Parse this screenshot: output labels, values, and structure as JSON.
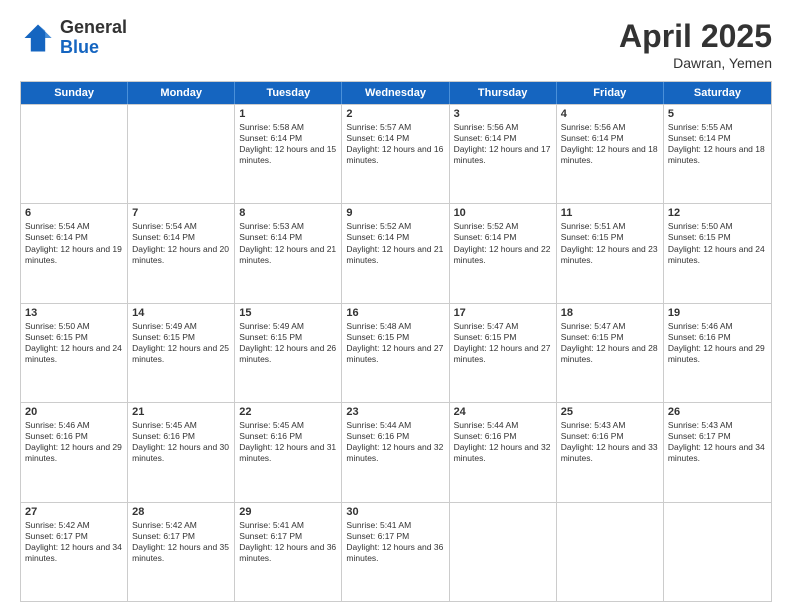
{
  "logo": {
    "general": "General",
    "blue": "Blue"
  },
  "title": {
    "main": "April 2025",
    "sub": "Dawran, Yemen"
  },
  "days": [
    "Sunday",
    "Monday",
    "Tuesday",
    "Wednesday",
    "Thursday",
    "Friday",
    "Saturday"
  ],
  "weeks": [
    [
      {
        "day": "",
        "info": ""
      },
      {
        "day": "",
        "info": ""
      },
      {
        "day": "1",
        "info": "Sunrise: 5:58 AM\nSunset: 6:14 PM\nDaylight: 12 hours and 15 minutes."
      },
      {
        "day": "2",
        "info": "Sunrise: 5:57 AM\nSunset: 6:14 PM\nDaylight: 12 hours and 16 minutes."
      },
      {
        "day": "3",
        "info": "Sunrise: 5:56 AM\nSunset: 6:14 PM\nDaylight: 12 hours and 17 minutes."
      },
      {
        "day": "4",
        "info": "Sunrise: 5:56 AM\nSunset: 6:14 PM\nDaylight: 12 hours and 18 minutes."
      },
      {
        "day": "5",
        "info": "Sunrise: 5:55 AM\nSunset: 6:14 PM\nDaylight: 12 hours and 18 minutes."
      }
    ],
    [
      {
        "day": "6",
        "info": "Sunrise: 5:54 AM\nSunset: 6:14 PM\nDaylight: 12 hours and 19 minutes."
      },
      {
        "day": "7",
        "info": "Sunrise: 5:54 AM\nSunset: 6:14 PM\nDaylight: 12 hours and 20 minutes."
      },
      {
        "day": "8",
        "info": "Sunrise: 5:53 AM\nSunset: 6:14 PM\nDaylight: 12 hours and 21 minutes."
      },
      {
        "day": "9",
        "info": "Sunrise: 5:52 AM\nSunset: 6:14 PM\nDaylight: 12 hours and 21 minutes."
      },
      {
        "day": "10",
        "info": "Sunrise: 5:52 AM\nSunset: 6:14 PM\nDaylight: 12 hours and 22 minutes."
      },
      {
        "day": "11",
        "info": "Sunrise: 5:51 AM\nSunset: 6:15 PM\nDaylight: 12 hours and 23 minutes."
      },
      {
        "day": "12",
        "info": "Sunrise: 5:50 AM\nSunset: 6:15 PM\nDaylight: 12 hours and 24 minutes."
      }
    ],
    [
      {
        "day": "13",
        "info": "Sunrise: 5:50 AM\nSunset: 6:15 PM\nDaylight: 12 hours and 24 minutes."
      },
      {
        "day": "14",
        "info": "Sunrise: 5:49 AM\nSunset: 6:15 PM\nDaylight: 12 hours and 25 minutes."
      },
      {
        "day": "15",
        "info": "Sunrise: 5:49 AM\nSunset: 6:15 PM\nDaylight: 12 hours and 26 minutes."
      },
      {
        "day": "16",
        "info": "Sunrise: 5:48 AM\nSunset: 6:15 PM\nDaylight: 12 hours and 27 minutes."
      },
      {
        "day": "17",
        "info": "Sunrise: 5:47 AM\nSunset: 6:15 PM\nDaylight: 12 hours and 27 minutes."
      },
      {
        "day": "18",
        "info": "Sunrise: 5:47 AM\nSunset: 6:15 PM\nDaylight: 12 hours and 28 minutes."
      },
      {
        "day": "19",
        "info": "Sunrise: 5:46 AM\nSunset: 6:16 PM\nDaylight: 12 hours and 29 minutes."
      }
    ],
    [
      {
        "day": "20",
        "info": "Sunrise: 5:46 AM\nSunset: 6:16 PM\nDaylight: 12 hours and 29 minutes."
      },
      {
        "day": "21",
        "info": "Sunrise: 5:45 AM\nSunset: 6:16 PM\nDaylight: 12 hours and 30 minutes."
      },
      {
        "day": "22",
        "info": "Sunrise: 5:45 AM\nSunset: 6:16 PM\nDaylight: 12 hours and 31 minutes."
      },
      {
        "day": "23",
        "info": "Sunrise: 5:44 AM\nSunset: 6:16 PM\nDaylight: 12 hours and 32 minutes."
      },
      {
        "day": "24",
        "info": "Sunrise: 5:44 AM\nSunset: 6:16 PM\nDaylight: 12 hours and 32 minutes."
      },
      {
        "day": "25",
        "info": "Sunrise: 5:43 AM\nSunset: 6:16 PM\nDaylight: 12 hours and 33 minutes."
      },
      {
        "day": "26",
        "info": "Sunrise: 5:43 AM\nSunset: 6:17 PM\nDaylight: 12 hours and 34 minutes."
      }
    ],
    [
      {
        "day": "27",
        "info": "Sunrise: 5:42 AM\nSunset: 6:17 PM\nDaylight: 12 hours and 34 minutes."
      },
      {
        "day": "28",
        "info": "Sunrise: 5:42 AM\nSunset: 6:17 PM\nDaylight: 12 hours and 35 minutes."
      },
      {
        "day": "29",
        "info": "Sunrise: 5:41 AM\nSunset: 6:17 PM\nDaylight: 12 hours and 36 minutes."
      },
      {
        "day": "30",
        "info": "Sunrise: 5:41 AM\nSunset: 6:17 PM\nDaylight: 12 hours and 36 minutes."
      },
      {
        "day": "",
        "info": ""
      },
      {
        "day": "",
        "info": ""
      },
      {
        "day": "",
        "info": ""
      }
    ]
  ]
}
